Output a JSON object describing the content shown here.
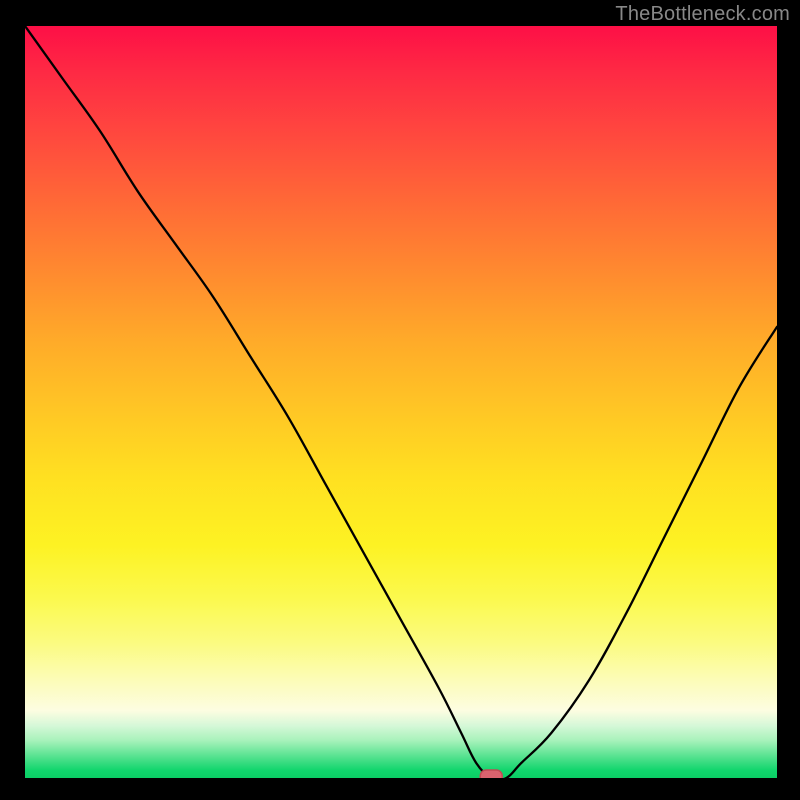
{
  "watermark": "TheBottleneck.com",
  "colors": {
    "frame": "#000000",
    "curve": "#000000",
    "marker_fill": "#d9636e",
    "marker_stroke": "#c24b55",
    "gradient_top": "#fd0f46",
    "gradient_mid": "#ffe021",
    "gradient_bottom": "#0bce65"
  },
  "labels": {
    "title": "",
    "xlabel": "",
    "ylabel": ""
  },
  "chart_data": {
    "type": "line",
    "title": "",
    "xlabel": "",
    "ylabel": "",
    "xlim": [
      0,
      100
    ],
    "ylim": [
      0,
      100
    ],
    "grid": false,
    "legend": false,
    "marker": {
      "x": 62,
      "y": 0
    },
    "series": [
      {
        "name": "bottleneck-curve",
        "x": [
          0,
          5,
          10,
          15,
          20,
          25,
          30,
          35,
          40,
          45,
          50,
          55,
          58,
          60,
          62,
          64,
          66,
          70,
          75,
          80,
          85,
          90,
          95,
          100
        ],
        "y": [
          100,
          93,
          86,
          78,
          71,
          64,
          56,
          48,
          39,
          30,
          21,
          12,
          6,
          2,
          0,
          0,
          2,
          6,
          13,
          22,
          32,
          42,
          52,
          60
        ]
      }
    ]
  }
}
